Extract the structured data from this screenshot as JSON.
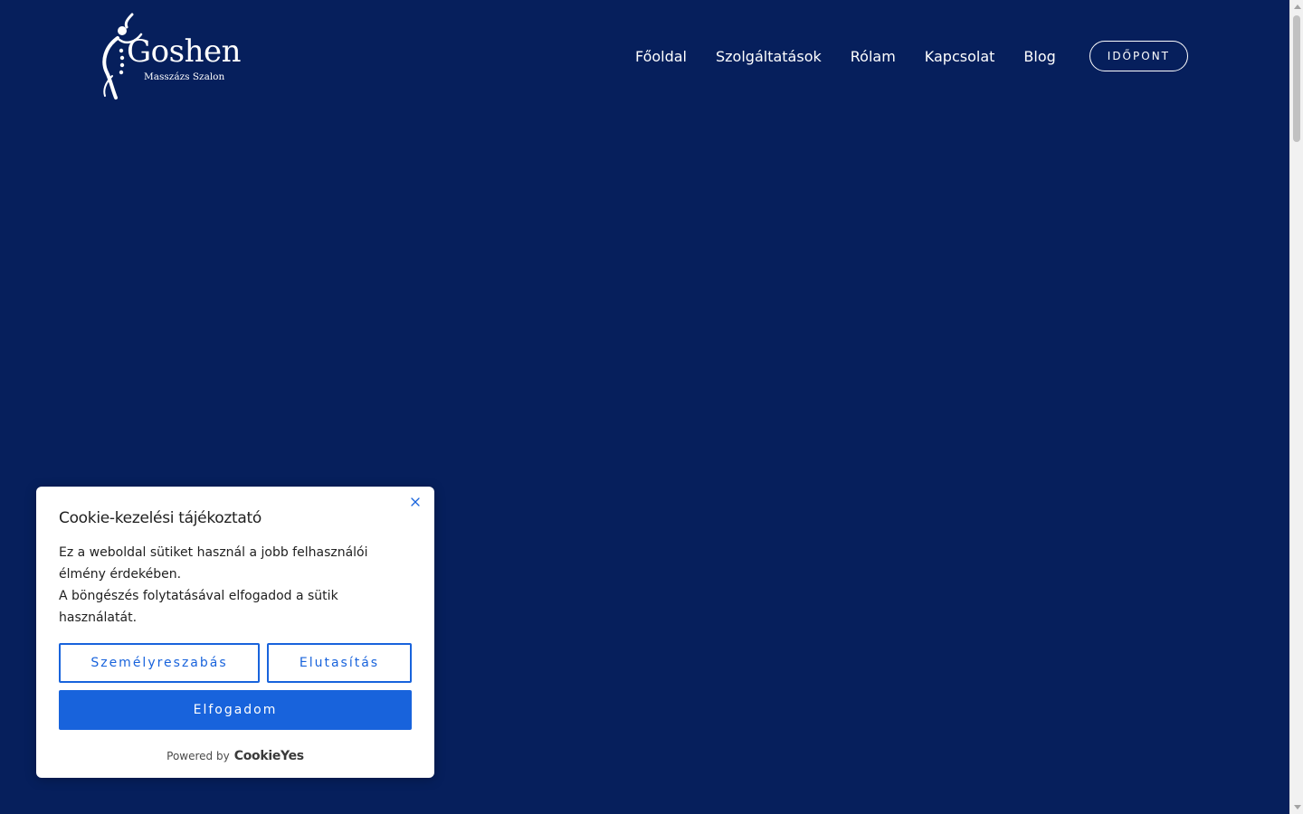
{
  "brand": {
    "name": "Goshen",
    "subtitle": "Masszázs Szalon"
  },
  "nav": {
    "items": [
      {
        "label": "Főoldal"
      },
      {
        "label": "Szolgáltatások"
      },
      {
        "label": "Rólam"
      },
      {
        "label": "Kapcsolat"
      },
      {
        "label": "Blog"
      }
    ],
    "cta_label": "IDŐPONT"
  },
  "cookie": {
    "title": "Cookie-kezelési tájékoztató",
    "text_line1": "Ez a weboldal sütiket használ a jobb felhasználói élmény érdekében.",
    "text_line2": "A böngészés folytatásával elfogadod a sütik használatát.",
    "customize_label": "Személyreszabás",
    "reject_label": "Elutasítás",
    "accept_label": "Elfogadom",
    "powered_by": "Powered by",
    "powered_brand": "CookieYes"
  },
  "colors": {
    "background": "#061f5c",
    "accent": "#1863dc"
  }
}
